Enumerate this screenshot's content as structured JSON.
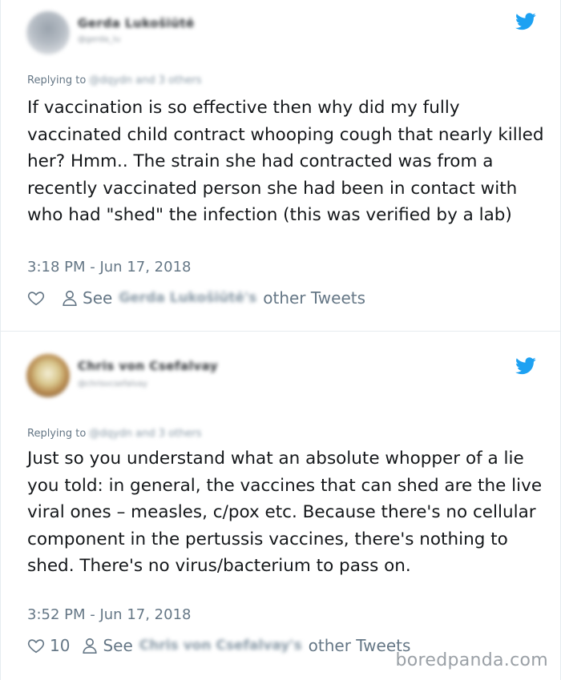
{
  "tweets": [
    {
      "author_name": "Gerda Lukošiūtė",
      "author_handle": "@gerda_lu",
      "replying_label": "Replying to",
      "replying_to": "@dqydn and 3 others",
      "text": "If vaccination is so effective then why did my fully vaccinated child contract whooping cough that nearly killed her? Hmm.. The strain she had contracted was from a recently vaccinated person she had been in contact with who had \"shed\" the infection (this was verified by a lab)",
      "timestamp": "3:18 PM - Jun 17, 2018",
      "likes": "",
      "see_label": "See",
      "see_name": "Gerda Lukošiūtė's",
      "other_tweets_label": "other Tweets",
      "icons": {
        "like": "heart-icon",
        "author": "person-icon",
        "brand": "twitter-bird-icon"
      }
    },
    {
      "author_name": "Chris von Csefalvay",
      "author_handle": "@chrisvcsefalvay",
      "replying_label": "Replying to",
      "replying_to": "@dqydn and 3 others",
      "text": "Just so you understand what an absolute whopper of a lie you told: in general, the vaccines that can shed are the live viral ones – measles, c/pox etc. Because there's no cellular component in the pertussis vaccines, there's nothing to shed. There's no virus/bacterium to pass on.",
      "timestamp": "3:52 PM - Jun 17, 2018",
      "likes": "10",
      "see_label": "See",
      "see_name": "Chris von Csefalvay's",
      "other_tweets_label": "other Tweets",
      "icons": {
        "like": "heart-icon",
        "author": "person-icon",
        "brand": "twitter-bird-icon"
      }
    }
  ],
  "watermark": "boredpanda.com",
  "colors": {
    "twitter_blue": "#1da1f2",
    "meta_gray": "#657786",
    "text": "#14171a",
    "border": "#e6ecf0"
  }
}
